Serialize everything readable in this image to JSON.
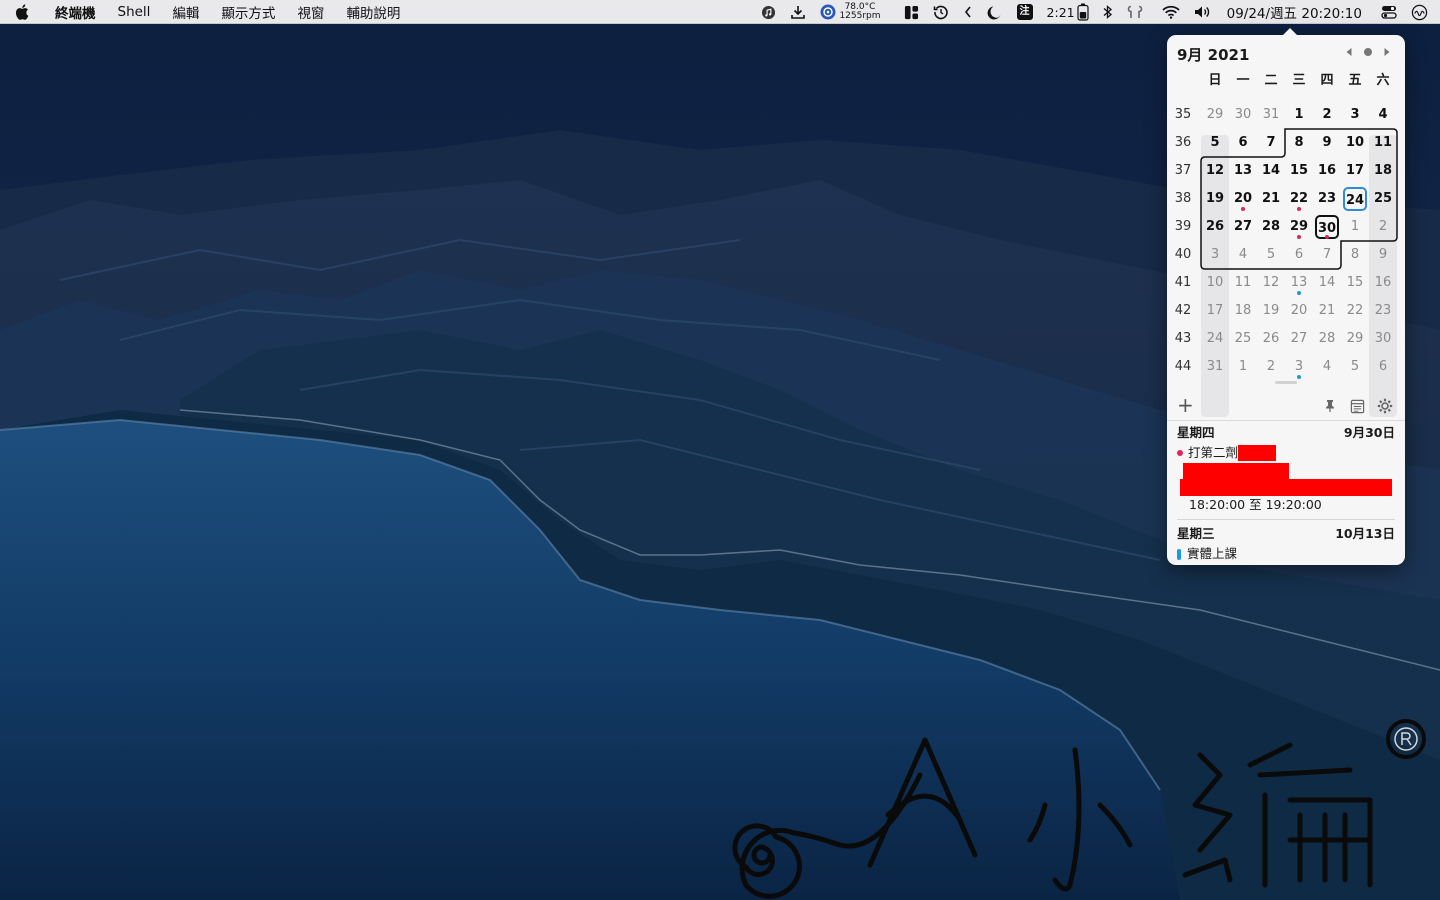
{
  "menubar": {
    "items": [
      "終端機",
      "Shell",
      "編輯",
      "顯示方式",
      "視窗",
      "輔助說明"
    ],
    "sensor_temp": "78.0°C",
    "sensor_fan": "1255rpm",
    "zhuyin_label": "注",
    "battery_time": "2:21",
    "clock": "09/24/週五 20:20:10",
    "icons": [
      "apple-icon",
      "music-icon",
      "download-icon",
      "sensor-icon",
      "layout-icon",
      "history-icon",
      "collapse-icon",
      "moon-icon",
      "input-method-icon",
      "battery-icon",
      "bluetooth-icon",
      "airpods-icon",
      "wifi-icon",
      "volume-icon",
      "control-center-icon",
      "siri-icon"
    ]
  },
  "calendar": {
    "title": "9月 2021",
    "weekday_headers": [
      "日",
      "一",
      "二",
      "三",
      "四",
      "五",
      "六"
    ],
    "weeks": [
      {
        "week": "35",
        "days": [
          "29",
          "30",
          "31",
          "1",
          "2",
          "3",
          "4"
        ]
      },
      {
        "week": "36",
        "days": [
          "5",
          "6",
          "7",
          "8",
          "9",
          "10",
          "11"
        ]
      },
      {
        "week": "37",
        "days": [
          "12",
          "13",
          "14",
          "15",
          "16",
          "17",
          "18"
        ]
      },
      {
        "week": "38",
        "days": [
          "19",
          "20",
          "21",
          "22",
          "23",
          "24",
          "25"
        ]
      },
      {
        "week": "39",
        "days": [
          "26",
          "27",
          "28",
          "29",
          "30",
          "1",
          "2"
        ]
      },
      {
        "week": "40",
        "days": [
          "3",
          "4",
          "5",
          "6",
          "7",
          "8",
          "9"
        ]
      },
      {
        "week": "41",
        "days": [
          "10",
          "11",
          "12",
          "13",
          "14",
          "15",
          "16"
        ]
      },
      {
        "week": "42",
        "days": [
          "17",
          "18",
          "19",
          "20",
          "21",
          "22",
          "23"
        ]
      },
      {
        "week": "43",
        "days": [
          "24",
          "25",
          "26",
          "27",
          "28",
          "29",
          "30"
        ]
      },
      {
        "week": "44",
        "days": [
          "31",
          "1",
          "2",
          "3",
          "4",
          "5",
          "6"
        ]
      }
    ],
    "today": {
      "row": 3,
      "col": 5
    },
    "selected": {
      "row": 4,
      "col": 4
    },
    "event_dots": [
      {
        "row": 3,
        "col": 1,
        "color": "#e0245e"
      },
      {
        "row": 3,
        "col": 3,
        "color": "#e0245e"
      },
      {
        "row": 4,
        "col": 3,
        "color": "#e0245e"
      },
      {
        "row": 4,
        "col": 4,
        "color": "#e0245e"
      },
      {
        "row": 6,
        "col": 3,
        "color": "#1a9ae0"
      },
      {
        "row": 9,
        "col": 3,
        "color": "#1a9ae0"
      }
    ]
  },
  "events": [
    {
      "weekday": "星期四",
      "date": "9月30日",
      "title": "打第二劑",
      "time": "18:20:00 至 19:20:00",
      "color": "#e0245e"
    },
    {
      "weekday": "星期三",
      "date": "10月13日",
      "title": "實體上課",
      "color": "#1a9ae0"
    }
  ],
  "colors": {
    "today_ring": "#2f8bd9",
    "redaction": "#ff0000"
  }
}
